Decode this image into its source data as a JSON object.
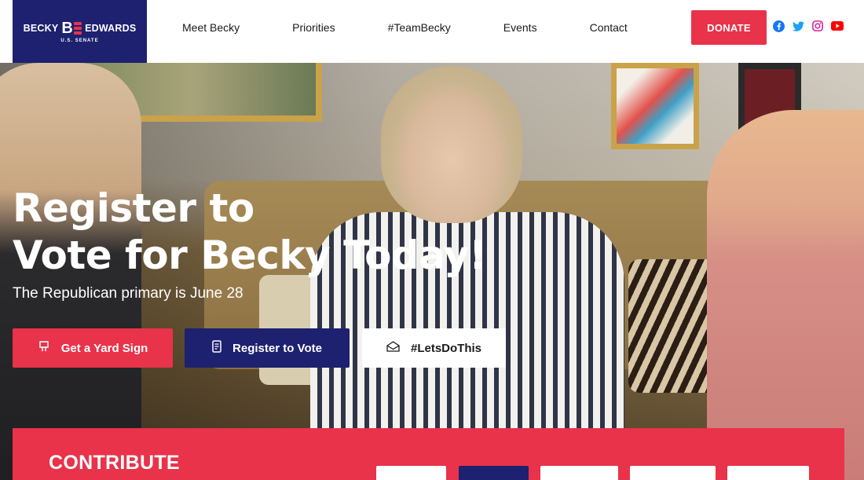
{
  "logo": {
    "left_text": "BECKY",
    "right_text": "EDWARDS",
    "mark": "B",
    "subtitle": "U.S. SENATE"
  },
  "nav": {
    "items": [
      "Meet Becky",
      "Priorities",
      "#TeamBecky",
      "Events",
      "Contact"
    ]
  },
  "header": {
    "donate_label": "DONATE"
  },
  "social": [
    "facebook-icon",
    "twitter-icon",
    "instagram-icon",
    "youtube-icon"
  ],
  "colors": {
    "brand_red": "#e8334a",
    "brand_navy": "#1d2170"
  },
  "hero": {
    "title_line1": "Register to",
    "title_line2": "Vote for Becky Today!",
    "subtitle": "The Republican primary is June 28",
    "buttons": {
      "yard_sign": "Get a Yard Sign",
      "register": "Register to Vote",
      "lets_do_this": "#LetsDoThis"
    }
  },
  "contribute": {
    "title": "CONTRIBUTE"
  }
}
